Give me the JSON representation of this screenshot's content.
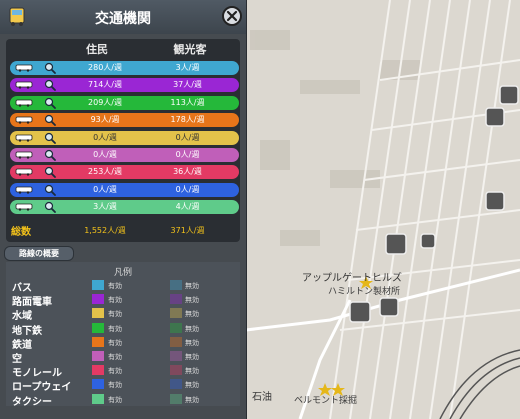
{
  "panel": {
    "title": "交通機関",
    "header_icon": "bus-icon",
    "close_icon": "close-icon",
    "columns": {
      "residents": "住民",
      "tourists": "観光客"
    },
    "rows": [
      {
        "key": "bus",
        "icon": "bus-icon",
        "color": "#3fa7d0",
        "residents": "280人/週",
        "tourists": "3人/週"
      },
      {
        "key": "tram",
        "icon": "tram-icon",
        "color": "#9a26d4",
        "residents": "714人/週",
        "tourists": "37人/週"
      },
      {
        "key": "metro",
        "icon": "metro-icon",
        "color": "#25b83a",
        "residents": "209人/週",
        "tourists": "113人/週"
      },
      {
        "key": "train",
        "icon": "train-icon",
        "color": "#e7751a",
        "residents": "93人/週",
        "tourists": "178人/週"
      },
      {
        "key": "ship",
        "icon": "ship-icon",
        "color": "#e3c24a",
        "residents": "0人/週",
        "tourists": "0人/週"
      },
      {
        "key": "plane",
        "icon": "plane-icon",
        "color": "#c05fb9",
        "residents": "0人/週",
        "tourists": "0人/週"
      },
      {
        "key": "monorail",
        "icon": "monorail-icon",
        "color": "#e33a64",
        "residents": "253人/週",
        "tourists": "36人/週"
      },
      {
        "key": "cablecar",
        "icon": "cablecar-icon",
        "color": "#2e62e0",
        "residents": "0人/週",
        "tourists": "0人/週"
      },
      {
        "key": "taxi",
        "icon": "taxi-icon",
        "color": "#5fcb8a",
        "residents": "3人/週",
        "tourists": "4人/週"
      }
    ],
    "total": {
      "label": "総数",
      "residents": "1,552人/週",
      "tourists": "371人/週"
    },
    "overview_button": "路線の概要",
    "legend": {
      "title": "凡例",
      "items": [
        {
          "label": "バス",
          "color": "#3fa7d0",
          "on": "有効",
          "off": "無効"
        },
        {
          "label": "路面電車",
          "color": "#9a26d4",
          "on": "有効",
          "off": "無効"
        },
        {
          "label": "水域",
          "color": "#e3c24a",
          "on": "有効",
          "off": "無効"
        },
        {
          "label": "地下鉄",
          "color": "#25b83a",
          "on": "有効",
          "off": "無効"
        },
        {
          "label": "鉄道",
          "color": "#e7751a",
          "on": "有効",
          "off": "無効"
        },
        {
          "label": "空",
          "color": "#c05fb9",
          "on": "有効",
          "off": "無効"
        },
        {
          "label": "モノレール",
          "color": "#e33a64",
          "on": "有効",
          "off": "無効"
        },
        {
          "label": "ロープウェイ",
          "color": "#2e62e0",
          "on": "有効",
          "off": "無効"
        },
        {
          "label": "タクシー",
          "color": "#5fcb8a",
          "on": "有効",
          "off": "無効"
        }
      ]
    }
  },
  "map": {
    "labels": {
      "district": "アップルゲートヒルズ",
      "facility": "ハミルトン製材所",
      "quarry": "ベルモント採掘",
      "stone": "石油"
    }
  }
}
